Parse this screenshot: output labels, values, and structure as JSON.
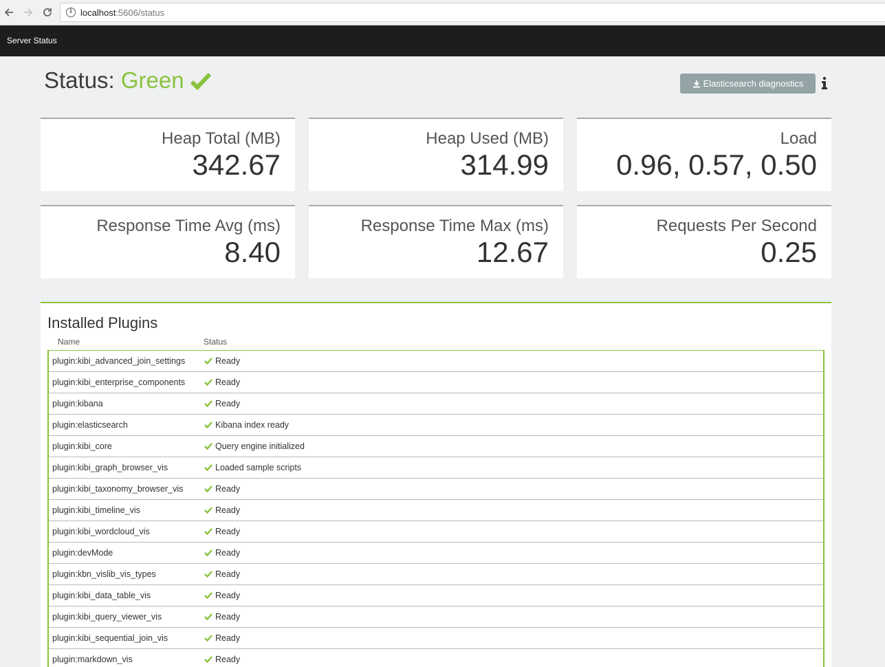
{
  "browser": {
    "url_host": "localhost",
    "url_path": ":5606/status"
  },
  "header": {
    "title": "Server Status"
  },
  "status": {
    "prefix": "Status: ",
    "value": "Green",
    "diagnostics_label": "Elasticsearch diagnostics"
  },
  "metrics": [
    {
      "label": "Heap Total (MB)",
      "value": "342.67"
    },
    {
      "label": "Heap Used (MB)",
      "value": "314.99"
    },
    {
      "label": "Load",
      "value": "0.96, 0.57, 0.50"
    },
    {
      "label": "Response Time Avg (ms)",
      "value": "8.40"
    },
    {
      "label": "Response Time Max (ms)",
      "value": "12.67"
    },
    {
      "label": "Requests Per Second",
      "value": "0.25"
    }
  ],
  "plugins": {
    "title": "Installed Plugins",
    "columns": {
      "name": "Name",
      "status": "Status"
    },
    "rows": [
      {
        "name": "plugin:kibi_advanced_join_settings",
        "status": "Ready"
      },
      {
        "name": "plugin:kibi_enterprise_components",
        "status": "Ready"
      },
      {
        "name": "plugin:kibana",
        "status": "Ready"
      },
      {
        "name": "plugin:elasticsearch",
        "status": "Kibana index ready"
      },
      {
        "name": "plugin:kibi_core",
        "status": "Query engine initialized"
      },
      {
        "name": "plugin:kibi_graph_browser_vis",
        "status": "Loaded sample scripts"
      },
      {
        "name": "plugin:kibi_taxonomy_browser_vis",
        "status": "Ready"
      },
      {
        "name": "plugin:kibi_timeline_vis",
        "status": "Ready"
      },
      {
        "name": "plugin:kibi_wordcloud_vis",
        "status": "Ready"
      },
      {
        "name": "plugin:devMode",
        "status": "Ready"
      },
      {
        "name": "plugin:kbn_vislib_vis_types",
        "status": "Ready"
      },
      {
        "name": "plugin:kibi_data_table_vis",
        "status": "Ready"
      },
      {
        "name": "plugin:kibi_query_viewer_vis",
        "status": "Ready"
      },
      {
        "name": "plugin:kibi_sequential_join_vis",
        "status": "Ready"
      },
      {
        "name": "plugin:markdown_vis",
        "status": "Ready"
      }
    ]
  },
  "colors": {
    "accent_green": "#8ac33d",
    "header_bg": "#1d1d1d",
    "button_bg": "#93a3a6"
  }
}
